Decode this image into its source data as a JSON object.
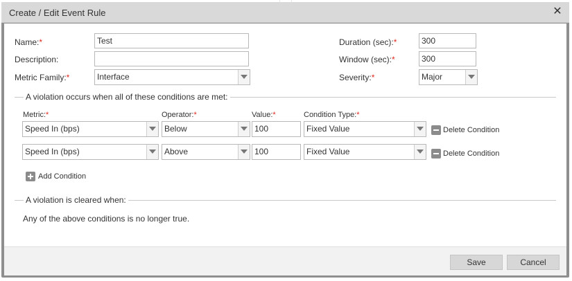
{
  "dialog": {
    "title": "Create / Edit Event Rule",
    "close_glyph": "✕"
  },
  "form": {
    "name": {
      "label": "Name:",
      "required": "*",
      "value": "Test"
    },
    "description": {
      "label": "Description:",
      "value": ""
    },
    "metric_family": {
      "label": "Metric Family:",
      "required": "*",
      "value": "Interface"
    },
    "duration": {
      "label": "Duration (sec):",
      "required": "*",
      "value": "300"
    },
    "window": {
      "label": "Window (sec):",
      "required": "*",
      "value": "300"
    },
    "severity": {
      "label": "Severity:",
      "required": "*",
      "value": "Major"
    }
  },
  "conditions": {
    "legend": "A violation occurs when all of these conditions are met:",
    "headers": {
      "metric": "Metric:",
      "operator": "Operator:",
      "value": "Value:",
      "condition_type": "Condition Type:",
      "required": "*"
    },
    "rows": [
      {
        "metric": "Speed In (bps)",
        "operator": "Below",
        "value": "100",
        "condition_type": "Fixed Value",
        "delete_label": "Delete Condition"
      },
      {
        "metric": "Speed In (bps)",
        "operator": "Above",
        "value": "100",
        "condition_type": "Fixed Value",
        "delete_label": "Delete Condition"
      }
    ],
    "add_label": "Add Condition"
  },
  "cleared": {
    "legend": "A violation is cleared when:",
    "text": "Any of the above conditions is no longer true."
  },
  "footer": {
    "save_label": "Save",
    "cancel_label": "Cancel"
  },
  "icons": {
    "close": "close-icon",
    "dropdown": "chevron-down-icon",
    "minus": "minus-icon",
    "plus": "plus-icon"
  }
}
